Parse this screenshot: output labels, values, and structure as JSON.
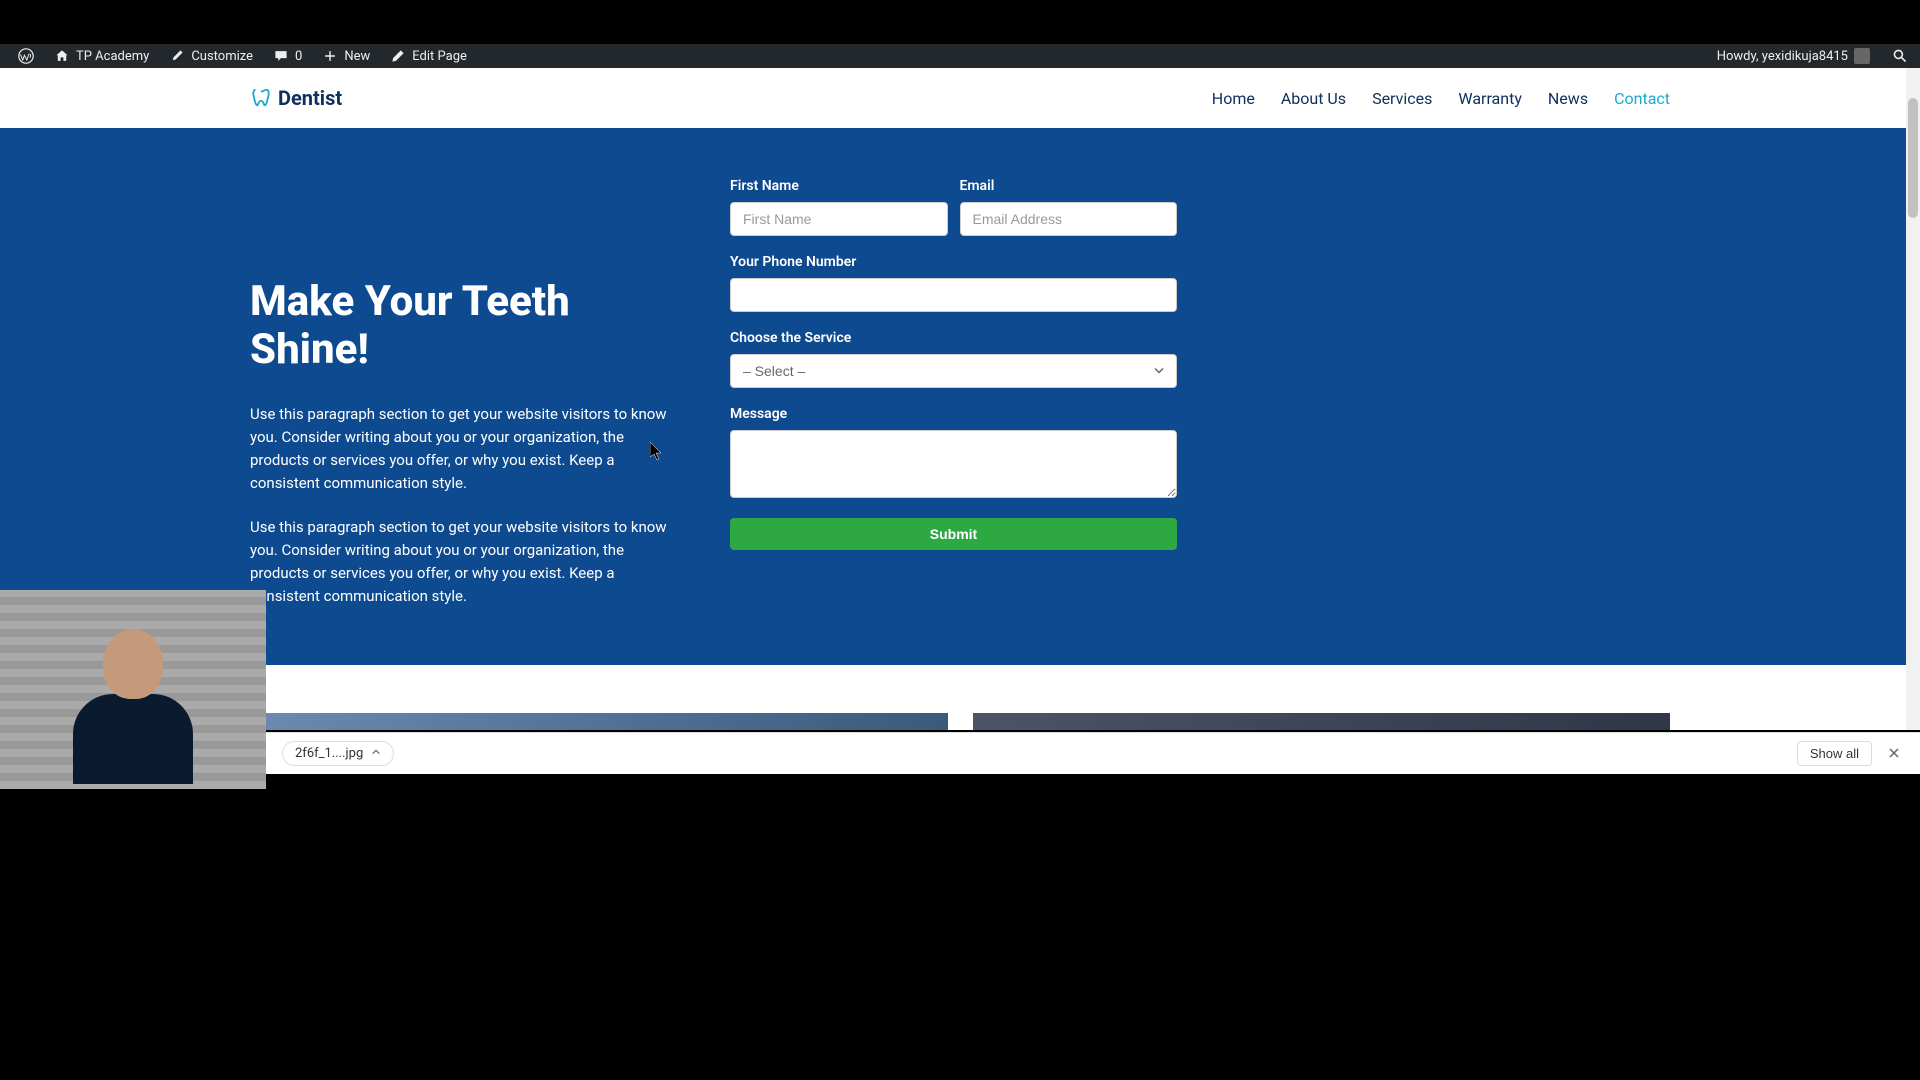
{
  "adminBar": {
    "siteName": "TP Academy",
    "customize": "Customize",
    "commentCount": "0",
    "new": "New",
    "editPage": "Edit Page",
    "howdy": "Howdy, yexidikuja8415"
  },
  "header": {
    "logoText": "Dentist",
    "nav": [
      {
        "label": "Home",
        "active": false
      },
      {
        "label": "About Us",
        "active": false
      },
      {
        "label": "Services",
        "active": false
      },
      {
        "label": "Warranty",
        "active": false
      },
      {
        "label": "News",
        "active": false
      },
      {
        "label": "Contact",
        "active": true
      }
    ]
  },
  "hero": {
    "title": "Make Your Teeth Shine!",
    "para1": "Use this paragraph section to get your website visitors to know you. Consider writing about you or your organization, the products or services you offer, or why you exist. Keep a consistent communication style.",
    "para2": "Use this paragraph section to get your website visitors to know you. Consider writing about you or your organization, the products or services you offer, or why you exist. Keep a consistent communication style."
  },
  "form": {
    "firstName": {
      "label": "First Name",
      "placeholder": "First Name"
    },
    "email": {
      "label": "Email",
      "placeholder": "Email Address"
    },
    "phone": {
      "label": "Your Phone Number"
    },
    "service": {
      "label": "Choose the Service",
      "selected": "– Select –"
    },
    "message": {
      "label": "Message"
    },
    "submit": "Submit"
  },
  "downloadBar": {
    "filename": "2f6f_1....jpg",
    "showAll": "Show all"
  }
}
